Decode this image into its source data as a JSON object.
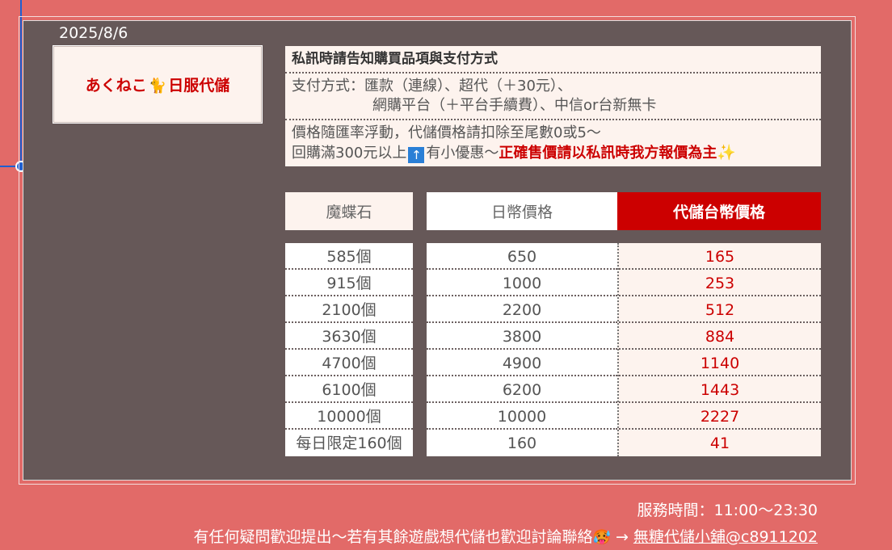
{
  "date": "2025/8/6",
  "shop": {
    "name_prefix": "あくねこ",
    "name_suffix": "日服代儲"
  },
  "info": {
    "title": "私訊時請告知購買品項與支付方式",
    "payment_line1": "支付方式：匯款（連線）、超代（＋30元）、",
    "payment_line2": "網購平台（＋平台手續費）、中信or台新無卡",
    "price_line1": "價格隨匯率浮動，代儲價格請扣除至尾數0或5～",
    "price_line2a": "回購滿300元以上",
    "price_line2b": "有小優惠～",
    "price_notice": "正確售價請以私訊時我方報價為主"
  },
  "table": {
    "headers": [
      "魔蝶石",
      "日幣價格",
      "代儲台幣價格"
    ],
    "rows": [
      [
        "585個",
        "650",
        "165"
      ],
      [
        "915個",
        "1000",
        "253"
      ],
      [
        "2100個",
        "2200",
        "512"
      ],
      [
        "3630個",
        "3800",
        "884"
      ],
      [
        "4700個",
        "4900",
        "1140"
      ],
      [
        "6100個",
        "6200",
        "1443"
      ],
      [
        "10000個",
        "10000",
        "2227"
      ],
      [
        "每日限定160個",
        "160",
        "41"
      ]
    ]
  },
  "footer": {
    "hours": "服務時間：11:00～23:30",
    "contact_text": "有任何疑問歡迎提出～若有其餘遊戲想代儲也歡迎討論聯絡",
    "arrow": "→",
    "link": "無糖代儲小舖@c8911202"
  },
  "colors": {
    "background": "#e26a68",
    "panel": "#665858",
    "accent": "#cc0000",
    "cream": "#fdf3ee",
    "selection": "#1f5fd1"
  }
}
